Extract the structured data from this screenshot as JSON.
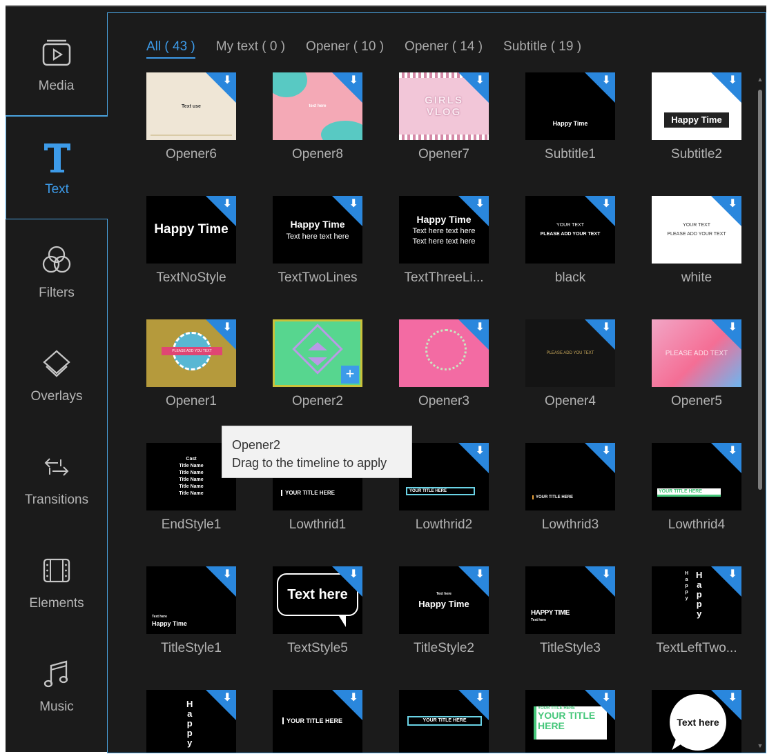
{
  "sidebar": {
    "items": [
      {
        "label": "Media",
        "icon": "media-icon"
      },
      {
        "label": "Text",
        "icon": "text-icon"
      },
      {
        "label": "Filters",
        "icon": "filters-icon"
      },
      {
        "label": "Overlays",
        "icon": "overlays-icon"
      },
      {
        "label": "Transitions",
        "icon": "transitions-icon"
      },
      {
        "label": "Elements",
        "icon": "elements-icon"
      },
      {
        "label": "Music",
        "icon": "music-icon"
      }
    ],
    "active": "Text"
  },
  "tabs": [
    {
      "label": "All ( 43 )"
    },
    {
      "label": "My text ( 0 )"
    },
    {
      "label": "Opener ( 10 )"
    },
    {
      "label": "Opener ( 14 )"
    },
    {
      "label": "Subtitle ( 19 )"
    }
  ],
  "thumb_text": {
    "opener6": "Text use",
    "opener8": "text here",
    "opener7": "GIRLS VLOG",
    "subtitle1": "Happy Time",
    "subtitle2": "Happy Time",
    "textnostyle": "Happy Time",
    "twolines": [
      "Happy Time",
      "Text here text here"
    ],
    "threelines": [
      "Happy Time",
      "Text here text here",
      "Text here text here"
    ],
    "black": [
      "YOUR TEXT",
      "PLEASE ADD YOUR TEXT"
    ],
    "white": [
      "YOUR TEXT",
      "PLEASE ADD YOUR TEXT"
    ],
    "opener1": "PLEASE ADD YOU TEXT",
    "opener4": "PLEASE ADD YOU TEXT",
    "opener5": "PLEASE ADD TEXT",
    "endstyle": [
      "Cast",
      "Title Name",
      "Title Name",
      "Title Name",
      "Title Name",
      "Title Name"
    ],
    "lowthrid1": "YOUR TITLE HERE",
    "lowthrid2": "YOUR TITLE HERE",
    "lowthrid3": "YOUR TITLE HERE",
    "lowthrid4": "YOUR TITLE HERE",
    "titlestyle1": [
      "Text here",
      "Happy Time"
    ],
    "textstyle5": "Text here",
    "titlestyle2": [
      "Text here",
      "Happy Time"
    ],
    "titlestyle3": [
      "HAPPY TIME",
      "Text here"
    ],
    "leftwo": [
      "H",
      "a",
      "p",
      "p",
      "y"
    ],
    "r6c1": [
      "H",
      "a",
      "p",
      "p",
      "y"
    ],
    "r6c2": "YOUR TITLE HERE",
    "r6c3": "YOUR TITLE HERE",
    "r6c4": [
      "YOUR TITLE HERE",
      "YOUR TITLE",
      "HERE"
    ],
    "r6c5": "Text here"
  },
  "items": [
    "Opener6",
    "Opener8",
    "Opener7",
    "Subtitle1",
    "Subtitle2",
    "TextNoStyle",
    "TextTwoLines",
    "TextThreeLi...",
    "black",
    "white",
    "Opener1",
    "Opener2",
    "Opener3",
    "Opener4",
    "Opener5",
    "EndStyle1",
    "Lowthrid1",
    "Lowthrid2",
    "Lowthrid3",
    "Lowthrid4",
    "TitleStyle1",
    "TextStyle5",
    "TitleStyle2",
    "TitleStyle3",
    "TextLeftTwo..."
  ],
  "tooltip": {
    "title": "Opener2",
    "text": "Drag to the timeline to apply"
  },
  "colors": {
    "accent": "#3d9be9",
    "download_badge": "#2a87dd",
    "selected_border": "#c9c23a"
  }
}
